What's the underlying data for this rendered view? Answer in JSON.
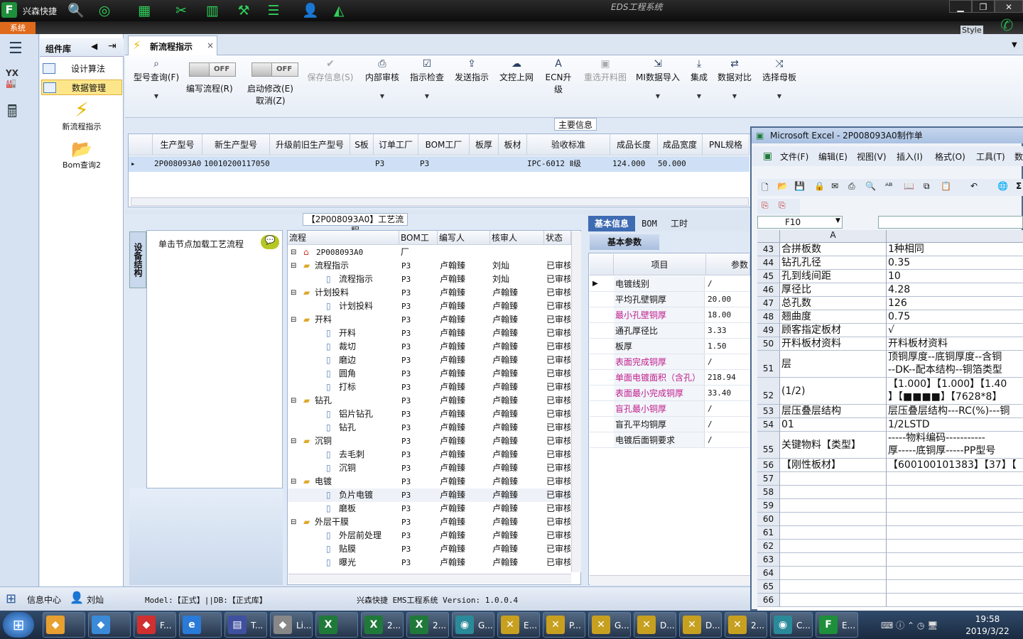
{
  "titlebar": {
    "app_name": "兴森快捷",
    "window_title": "EDS工程系统",
    "style_label": "Style",
    "system_tab": "系统"
  },
  "component_panel": {
    "title": "组件库",
    "items": [
      {
        "label": "设计算法"
      },
      {
        "label": "数据管理"
      }
    ],
    "big_items": [
      {
        "label": "新流程指示"
      },
      {
        "label": "Bom查询2"
      }
    ]
  },
  "main_tab": {
    "label": "新流程指示",
    "close": "×"
  },
  "ribbon": {
    "buttons": [
      {
        "label": "型号查询(F)",
        "icon": "search",
        "enabled": true
      },
      {
        "label": "保存信息(S)",
        "icon": "check",
        "enabled": false
      },
      {
        "label": "内部审核",
        "icon": "print",
        "enabled": true
      },
      {
        "label": "指示检查",
        "icon": "check",
        "enabled": true
      },
      {
        "label": "发送指示",
        "icon": "upload",
        "enabled": true
      },
      {
        "label": "文控上网",
        "icon": "cloud",
        "enabled": true
      },
      {
        "label": "ECN升级",
        "icon": "A",
        "enabled": true
      },
      {
        "label": "重选开料图",
        "icon": "image",
        "enabled": false
      },
      {
        "label": "MI数据导入",
        "icon": "import",
        "enabled": true
      },
      {
        "label": "集成",
        "icon": "download",
        "enabled": true
      },
      {
        "label": "数据对比",
        "icon": "compare",
        "enabled": true
      },
      {
        "label": "选择母板",
        "icon": "shuffle",
        "enabled": true
      }
    ],
    "toggle_edit": {
      "state": "OFF",
      "label": "编写流程(R)"
    },
    "toggle_modify": {
      "state": "OFF",
      "label": "启动修改(E)",
      "label2": "取消(Z)"
    }
  },
  "main_info": {
    "title": "主要信息",
    "columns": [
      "生产型号",
      "新生产型号",
      "升级前旧生产型号",
      "S板",
      "订单工厂",
      "BOM工厂",
      "板厚",
      "板材",
      "验收标准",
      "成品长度",
      "成品宽度",
      "PNL规格"
    ],
    "row": [
      "2P008093A0",
      "10010200117050",
      "",
      "",
      "P3",
      "P3",
      "",
      "",
      "IPC-6012 Ⅱ级",
      "124.000",
      "50.000",
      ""
    ]
  },
  "process": {
    "title": "【2P008093A0】工艺流程",
    "left_tab": "设备结构",
    "left_hint": "单击节点加载工艺流程",
    "columns": [
      "流程",
      "BOM工厂",
      "编写人",
      "核审人",
      "状态"
    ],
    "root": "2P008093A0",
    "rows": [
      {
        "name": "流程指示",
        "level": 1,
        "factory": "P3",
        "author": "卢翰臻",
        "reviewer": "刘灿",
        "status": "已审核"
      },
      {
        "name": "流程指示",
        "level": 2,
        "factory": "P3",
        "author": "卢翰臻",
        "reviewer": "刘灿",
        "status": "已审核"
      },
      {
        "name": "计划投料",
        "level": 1,
        "factory": "P3",
        "author": "卢翰臻",
        "reviewer": "卢翰臻",
        "status": "已审核"
      },
      {
        "name": "计划投料",
        "level": 2,
        "factory": "P3",
        "author": "卢翰臻",
        "reviewer": "卢翰臻",
        "status": "已审核"
      },
      {
        "name": "开料",
        "level": 1,
        "factory": "P3",
        "author": "卢翰臻",
        "reviewer": "卢翰臻",
        "status": "已审核"
      },
      {
        "name": "开料",
        "level": 2,
        "factory": "P3",
        "author": "卢翰臻",
        "reviewer": "卢翰臻",
        "status": "已审核"
      },
      {
        "name": "裁切",
        "level": 2,
        "factory": "P3",
        "author": "卢翰臻",
        "reviewer": "卢翰臻",
        "status": "已审核"
      },
      {
        "name": "磨边",
        "level": 2,
        "factory": "P3",
        "author": "卢翰臻",
        "reviewer": "卢翰臻",
        "status": "已审核"
      },
      {
        "name": "圆角",
        "level": 2,
        "factory": "P3",
        "author": "卢翰臻",
        "reviewer": "卢翰臻",
        "status": "已审核"
      },
      {
        "name": "打标",
        "level": 2,
        "factory": "P3",
        "author": "卢翰臻",
        "reviewer": "卢翰臻",
        "status": "已审核"
      },
      {
        "name": "钻孔",
        "level": 1,
        "factory": "P3",
        "author": "卢翰臻",
        "reviewer": "卢翰臻",
        "status": "已审核"
      },
      {
        "name": "铝片钻孔",
        "level": 2,
        "factory": "P3",
        "author": "卢翰臻",
        "reviewer": "卢翰臻",
        "status": "已审核"
      },
      {
        "name": "钻孔",
        "level": 2,
        "factory": "P3",
        "author": "卢翰臻",
        "reviewer": "卢翰臻",
        "status": "已审核"
      },
      {
        "name": "沉铜",
        "level": 1,
        "factory": "P3",
        "author": "卢翰臻",
        "reviewer": "卢翰臻",
        "status": "已审核"
      },
      {
        "name": "去毛刺",
        "level": 2,
        "factory": "P3",
        "author": "卢翰臻",
        "reviewer": "卢翰臻",
        "status": "已审核"
      },
      {
        "name": "沉铜",
        "level": 2,
        "factory": "P3",
        "author": "卢翰臻",
        "reviewer": "卢翰臻",
        "status": "已审核"
      },
      {
        "name": "电镀",
        "level": 1,
        "factory": "P3",
        "author": "卢翰臻",
        "reviewer": "卢翰臻",
        "status": "已审核"
      },
      {
        "name": "负片电镀",
        "level": 2,
        "factory": "P3",
        "author": "卢翰臻",
        "reviewer": "卢翰臻",
        "status": "已审核"
      },
      {
        "name": "磨板",
        "level": 2,
        "factory": "P3",
        "author": "卢翰臻",
        "reviewer": "卢翰臻",
        "status": "已审核"
      },
      {
        "name": "外层干膜",
        "level": 1,
        "factory": "P3",
        "author": "卢翰臻",
        "reviewer": "卢翰臻",
        "status": "已审核"
      },
      {
        "name": "外层前处理",
        "level": 2,
        "factory": "P3",
        "author": "卢翰臻",
        "reviewer": "卢翰臻",
        "status": "已审核"
      },
      {
        "name": "贴膜",
        "level": 2,
        "factory": "P3",
        "author": "卢翰臻",
        "reviewer": "卢翰臻",
        "status": "已审核"
      },
      {
        "name": "曝光",
        "level": 2,
        "factory": "P3",
        "author": "卢翰臻",
        "reviewer": "卢翰臻",
        "status": "已审核"
      }
    ]
  },
  "basic_info": {
    "tabs": [
      "基本信息",
      "BOM",
      "工时"
    ],
    "sub_tab": "基本参数",
    "columns": [
      "项目",
      "参数"
    ],
    "rows": [
      {
        "key": "电镀线别",
        "value": "/",
        "highlight": false
      },
      {
        "key": "平均孔壁铜厚",
        "value": "20.00",
        "highlight": false
      },
      {
        "key": "最小孔壁铜厚",
        "value": "18.00",
        "highlight": true
      },
      {
        "key": "通孔厚径比",
        "value": "3.33",
        "highlight": false
      },
      {
        "key": "板厚",
        "value": "1.50",
        "highlight": false
      },
      {
        "key": "表面完成铜厚",
        "value": "/",
        "highlight": true
      },
      {
        "key": "单面电镀面积（含孔）",
        "value": "218.94",
        "highlight": true
      },
      {
        "key": "表面最小完成铜厚",
        "value": "33.40",
        "highlight": true
      },
      {
        "key": "盲孔最小铜厚",
        "value": "/",
        "highlight": true
      },
      {
        "key": "盲孔平均铜厚",
        "value": "/",
        "highlight": false
      },
      {
        "key": "电镀后面铜要求",
        "value": "/",
        "highlight": false
      }
    ]
  },
  "statusbar": {
    "info_center": "信息中心",
    "user": "刘灿",
    "model_text": "Model:【正式】||DB:【正式库】",
    "version_text": "兴森快捷  EMS工程系统  Version: 1.0.0.4"
  },
  "excel": {
    "title": "Microsoft Excel - 2P008093A0制作单",
    "menu": [
      "文件(F)",
      "编辑(E)",
      "视图(V)",
      "插入(I)",
      "格式(O)",
      "工具(T)",
      "数"
    ],
    "name_box": "F10",
    "fx": "fx",
    "col_a": "A",
    "rows": [
      {
        "n": "43",
        "a": "合拼板数",
        "b": "1种相同",
        "h": 19
      },
      {
        "n": "44",
        "a": "钻孔孔径",
        "b": "0.35",
        "h": 19
      },
      {
        "n": "45",
        "a": "孔到线间距",
        "b": "10",
        "h": 19
      },
      {
        "n": "46",
        "a": "厚径比",
        "b": "4.28",
        "h": 19
      },
      {
        "n": "47",
        "a": "总孔数",
        "b": "126",
        "h": 19
      },
      {
        "n": "48",
        "a": "翘曲度",
        "b": "0.75",
        "h": 19
      },
      {
        "n": "49",
        "a": "顾客指定板材",
        "b": "√",
        "h": 19
      },
      {
        "n": "50",
        "a": "开料板材资料",
        "b": "开料板材资料",
        "h": 19
      },
      {
        "n": "51",
        "a": "层",
        "b": "顶铜厚度--底铜厚度--含铜",
        "b2": "--DK--配本结构--铜箔类型",
        "h": 38
      },
      {
        "n": "52",
        "a": "(1/2)",
        "b": "【1.000】【1.000】【1.40",
        "b2": "】【■■■■】【7628*8】",
        "h": 38
      },
      {
        "n": "53",
        "a": "层压叠层结构",
        "b": "层压叠层结构---RC(%)---铜",
        "h": 19
      },
      {
        "n": "54",
        "a": "01",
        "b": "1/2LSTD",
        "h": 19
      },
      {
        "n": "55",
        "a": "关键物料【类型】",
        "b": "-----物料编码-----------",
        "b2": "厚-----底铜厚-----PP型号",
        "h": 38
      },
      {
        "n": "56",
        "a": "【刚性板材】",
        "b": "【600100101383】【37】【",
        "h": 19
      },
      {
        "n": "57",
        "a": "",
        "b": "",
        "h": 19
      },
      {
        "n": "58",
        "a": "",
        "b": "",
        "h": 19
      },
      {
        "n": "59",
        "a": "",
        "b": "",
        "h": 19
      },
      {
        "n": "60",
        "a": "",
        "b": "",
        "h": 19
      },
      {
        "n": "61",
        "a": "",
        "b": "",
        "h": 19
      },
      {
        "n": "62",
        "a": "",
        "b": "",
        "h": 19
      },
      {
        "n": "63",
        "a": "",
        "b": "",
        "h": 19
      },
      {
        "n": "64",
        "a": "",
        "b": "",
        "h": 19
      },
      {
        "n": "65",
        "a": "",
        "b": "",
        "h": 19
      },
      {
        "n": "66",
        "a": "",
        "b": "",
        "h": 19
      }
    ]
  },
  "taskbar": {
    "items": [
      {
        "label": "",
        "icon": "shell-icon",
        "color": "#e8a030"
      },
      {
        "label": "",
        "icon": "bird-icon",
        "color": "#3a8ad8"
      },
      {
        "label": "F...",
        "icon": "foxmail-icon",
        "color": "#d03030"
      },
      {
        "label": "",
        "icon": "ie-icon",
        "color": "#2a7ad8"
      },
      {
        "label": "T...",
        "icon": "disk-icon",
        "color": "#4050a0"
      },
      {
        "label": "Li...",
        "icon": "scanner-icon",
        "color": "#888888"
      },
      {
        "label": "",
        "icon": "excel-icon",
        "color": "#1f7a3a"
      },
      {
        "label": "2...",
        "icon": "excel-icon",
        "color": "#1f7a3a"
      },
      {
        "label": "2...",
        "icon": "excel-icon",
        "color": "#1f7a3a"
      },
      {
        "label": "G...",
        "icon": "eye-icon",
        "color": "#2a8a9a"
      },
      {
        "label": "E...",
        "icon": "x-icon",
        "color": "#c8a020"
      },
      {
        "label": "P...",
        "icon": "x-icon",
        "color": "#c8a020"
      },
      {
        "label": "G...",
        "icon": "x-icon",
        "color": "#c8a020"
      },
      {
        "label": "D...",
        "icon": "x-icon",
        "color": "#c8a020"
      },
      {
        "label": "D...",
        "icon": "x-icon",
        "color": "#c8a020"
      },
      {
        "label": "2...",
        "icon": "x-icon",
        "color": "#c8a020"
      },
      {
        "label": "C...",
        "icon": "eye-icon",
        "color": "#2a8a9a"
      },
      {
        "label": "E...",
        "icon": "f-icon",
        "color": "#1e8f3a"
      }
    ],
    "time": "19:58",
    "date": "2019/3/22"
  }
}
